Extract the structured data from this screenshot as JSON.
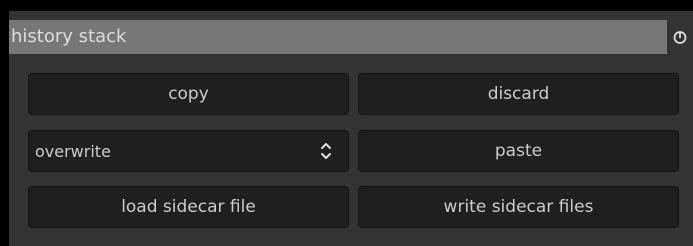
{
  "module": {
    "title": "history stack",
    "reset_icon": "power-icon"
  },
  "buttons": {
    "copy": "copy",
    "discard": "discard",
    "paste": "paste",
    "load_sidecar": "load sidecar file",
    "write_sidecar": "write sidecar files"
  },
  "mode_combo": {
    "selected": "overwrite",
    "icon": "updown-chevron-icon"
  },
  "colors": {
    "background": "#000000",
    "panel": "#333333",
    "header": "#777777",
    "button": "#1f1f1f",
    "text": "#cccccc"
  }
}
